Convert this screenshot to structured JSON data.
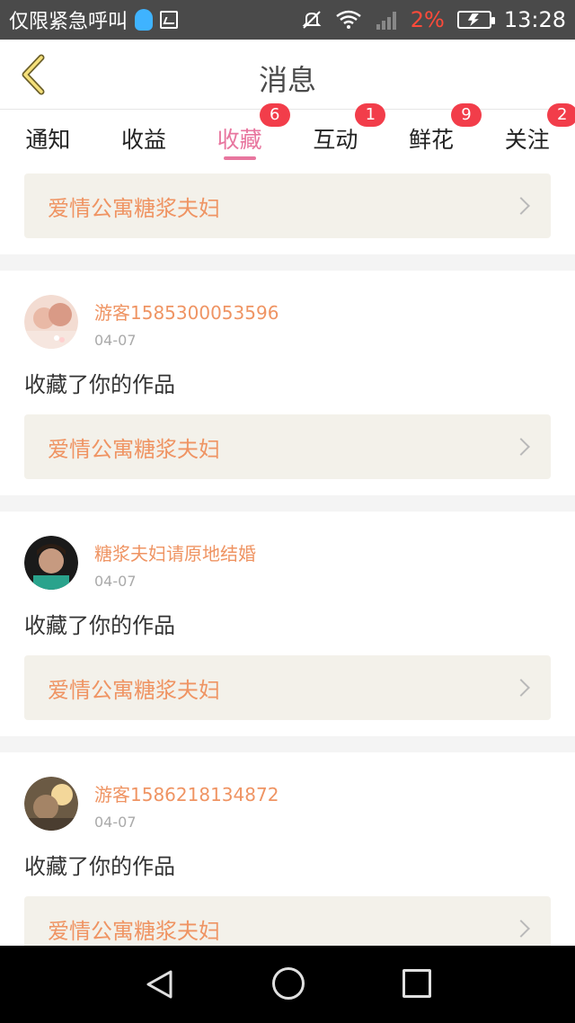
{
  "status_bar": {
    "carrier_text": "仅限紧急呼叫",
    "battery_pct": "2%",
    "time": "13:28"
  },
  "header": {
    "title": "消息"
  },
  "tabs": [
    {
      "label": "通知",
      "badge": ""
    },
    {
      "label": "收益",
      "badge": ""
    },
    {
      "label": "收藏",
      "badge": "6",
      "active": true
    },
    {
      "label": "互动",
      "badge": "1"
    },
    {
      "label": "鲜花",
      "badge": "9"
    },
    {
      "label": "关注",
      "badge": "2"
    }
  ],
  "items": [
    {
      "work_title": "爱情公寓糖浆夫妇"
    },
    {
      "username": "游客1585300053596",
      "date": "04-07",
      "action": "收藏了你的作品",
      "work_title": "爱情公寓糖浆夫妇"
    },
    {
      "username": "糖浆夫妇请原地结婚",
      "date": "04-07",
      "action": "收藏了你的作品",
      "work_title": "爱情公寓糖浆夫妇"
    },
    {
      "username": "游客1586218134872",
      "date": "04-07",
      "action": "收藏了你的作品",
      "work_title": "爱情公寓糖浆夫妇"
    }
  ],
  "colors": {
    "accent": "#e8769f",
    "badge": "#f23d4a",
    "username": "#ef9463",
    "work_box_bg": "#f3f1ea"
  }
}
